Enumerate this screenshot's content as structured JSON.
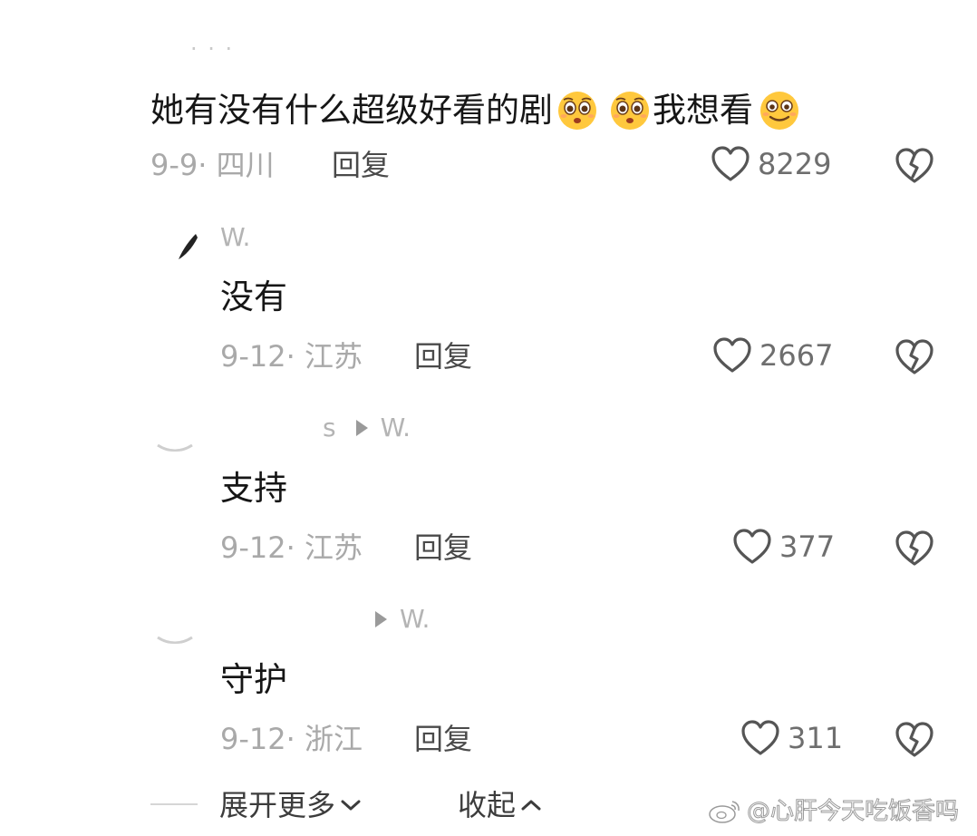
{
  "top_user_partial": "· · ·",
  "comments": [
    {
      "text": "她有没有什么超级好看的剧",
      "text_suffix": "我想看",
      "date": "9-9",
      "location": "四川",
      "reply_label": "回复",
      "likes": "8229"
    }
  ],
  "replies": [
    {
      "user": "W.",
      "reply_to": "",
      "text": "没有",
      "date": "9-12",
      "location": "江苏",
      "reply_label": "回复",
      "likes": "2667"
    },
    {
      "user": "s",
      "reply_to": "W.",
      "text": "支持",
      "date": "9-12",
      "location": "江苏",
      "reply_label": "回复",
      "likes": "377"
    },
    {
      "user": "",
      "reply_to": "W.",
      "text": "守护",
      "date": "9-12",
      "location": "浙江",
      "reply_label": "回复",
      "likes": "311"
    }
  ],
  "footer": {
    "expand_label": "展开更多",
    "collapse_label": "收起"
  },
  "watermark": "@心肝今天吃饭香吗",
  "icons": {
    "like": "heart-outline-icon",
    "dislike": "broken-heart-icon",
    "expand": "chevron-down-icon",
    "collapse": "chevron-up-icon",
    "emoji_1": "pleading-face-emoji",
    "emoji_2": "pleading-face-emoji",
    "emoji_3": "smiling-face-emoji",
    "watermark_logo": "weibo-logo-icon"
  },
  "colors": {
    "text": "#161616",
    "meta": "#a9a9a9",
    "reply": "#4a4a4a",
    "count": "#6e6e6e",
    "icon": "#555555",
    "emoji_yellow": "#ffc83d"
  }
}
